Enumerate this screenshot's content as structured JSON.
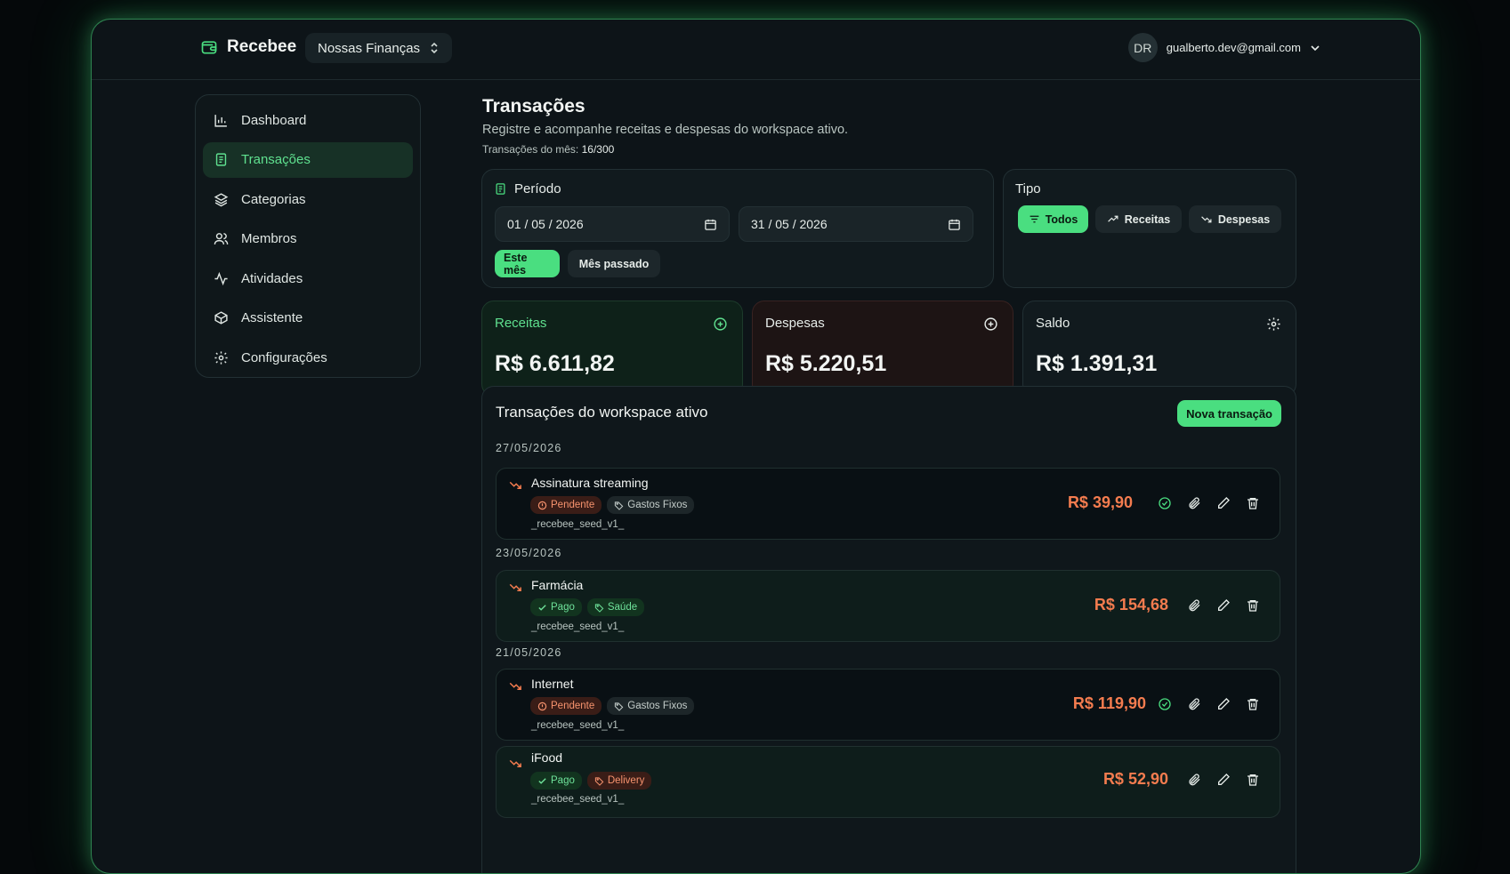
{
  "brand": {
    "name": "Recebee"
  },
  "workspace": {
    "name": "Nossas Finanças"
  },
  "user": {
    "initials": "DR",
    "email": "gualberto.dev@gmail.com"
  },
  "sidebar": {
    "items": [
      {
        "label": "Dashboard",
        "icon": "bar-chart-icon",
        "active": false
      },
      {
        "label": "Transações",
        "icon": "receipt-icon",
        "active": true
      },
      {
        "label": "Categorias",
        "icon": "layers-icon",
        "active": false
      },
      {
        "label": "Membros",
        "icon": "users-icon",
        "active": false
      },
      {
        "label": "Atividades",
        "icon": "activity-icon",
        "active": false
      },
      {
        "label": "Assistente",
        "icon": "bot-icon",
        "active": false
      },
      {
        "label": "Configurações",
        "icon": "gear-icon",
        "active": false
      }
    ]
  },
  "page": {
    "title": "Transações",
    "subtitle": "Registre e acompanhe receitas e despesas do workspace ativo.",
    "count_label": "Transações do mês:",
    "count_value": "16/300"
  },
  "period": {
    "label": "Período",
    "start": "01 / 05 / 2026",
    "end": "31 / 05 / 2026",
    "this_month": "Este mês",
    "last_month": "Mês passado"
  },
  "type_filter": {
    "label": "Tipo",
    "options": [
      "Todos",
      "Receitas",
      "Despesas"
    ],
    "selected": "Todos"
  },
  "stats": {
    "income": {
      "label": "Receitas",
      "value": "R$ 6.611,82"
    },
    "expense": {
      "label": "Despesas",
      "value": "R$ 5.220,51"
    },
    "balance": {
      "label": "Saldo",
      "value": "R$ 1.391,31"
    }
  },
  "list": {
    "title": "Transações do workspace ativo",
    "new_button": "Nova transação",
    "groups": [
      {
        "date": "27/05/2026",
        "items": [
          {
            "name": "Assinatura streaming",
            "status": "Pendente",
            "category": "Gastos Fixos",
            "description": "_recebee_seed_v1_",
            "amount": "R$ 39,90"
          }
        ]
      },
      {
        "date": "23/05/2026",
        "items": [
          {
            "name": "Farmácia",
            "status": "Pago",
            "category": "Saúde",
            "description": "_recebee_seed_v1_",
            "amount": "R$ 154,68"
          }
        ]
      },
      {
        "date": "21/05/2026",
        "items": [
          {
            "name": "Internet",
            "status": "Pendente",
            "category": "Gastos Fixos",
            "description": "_recebee_seed_v1_",
            "amount": "R$ 119,90"
          },
          {
            "name": "iFood",
            "status": "Pago",
            "category": "Delivery",
            "description": "_recebee_seed_v1_",
            "amount": "R$ 52,90"
          }
        ]
      }
    ]
  },
  "colors": {
    "accent": "#4ade80",
    "expense": "#f47c4f",
    "background": "#0d1418"
  }
}
